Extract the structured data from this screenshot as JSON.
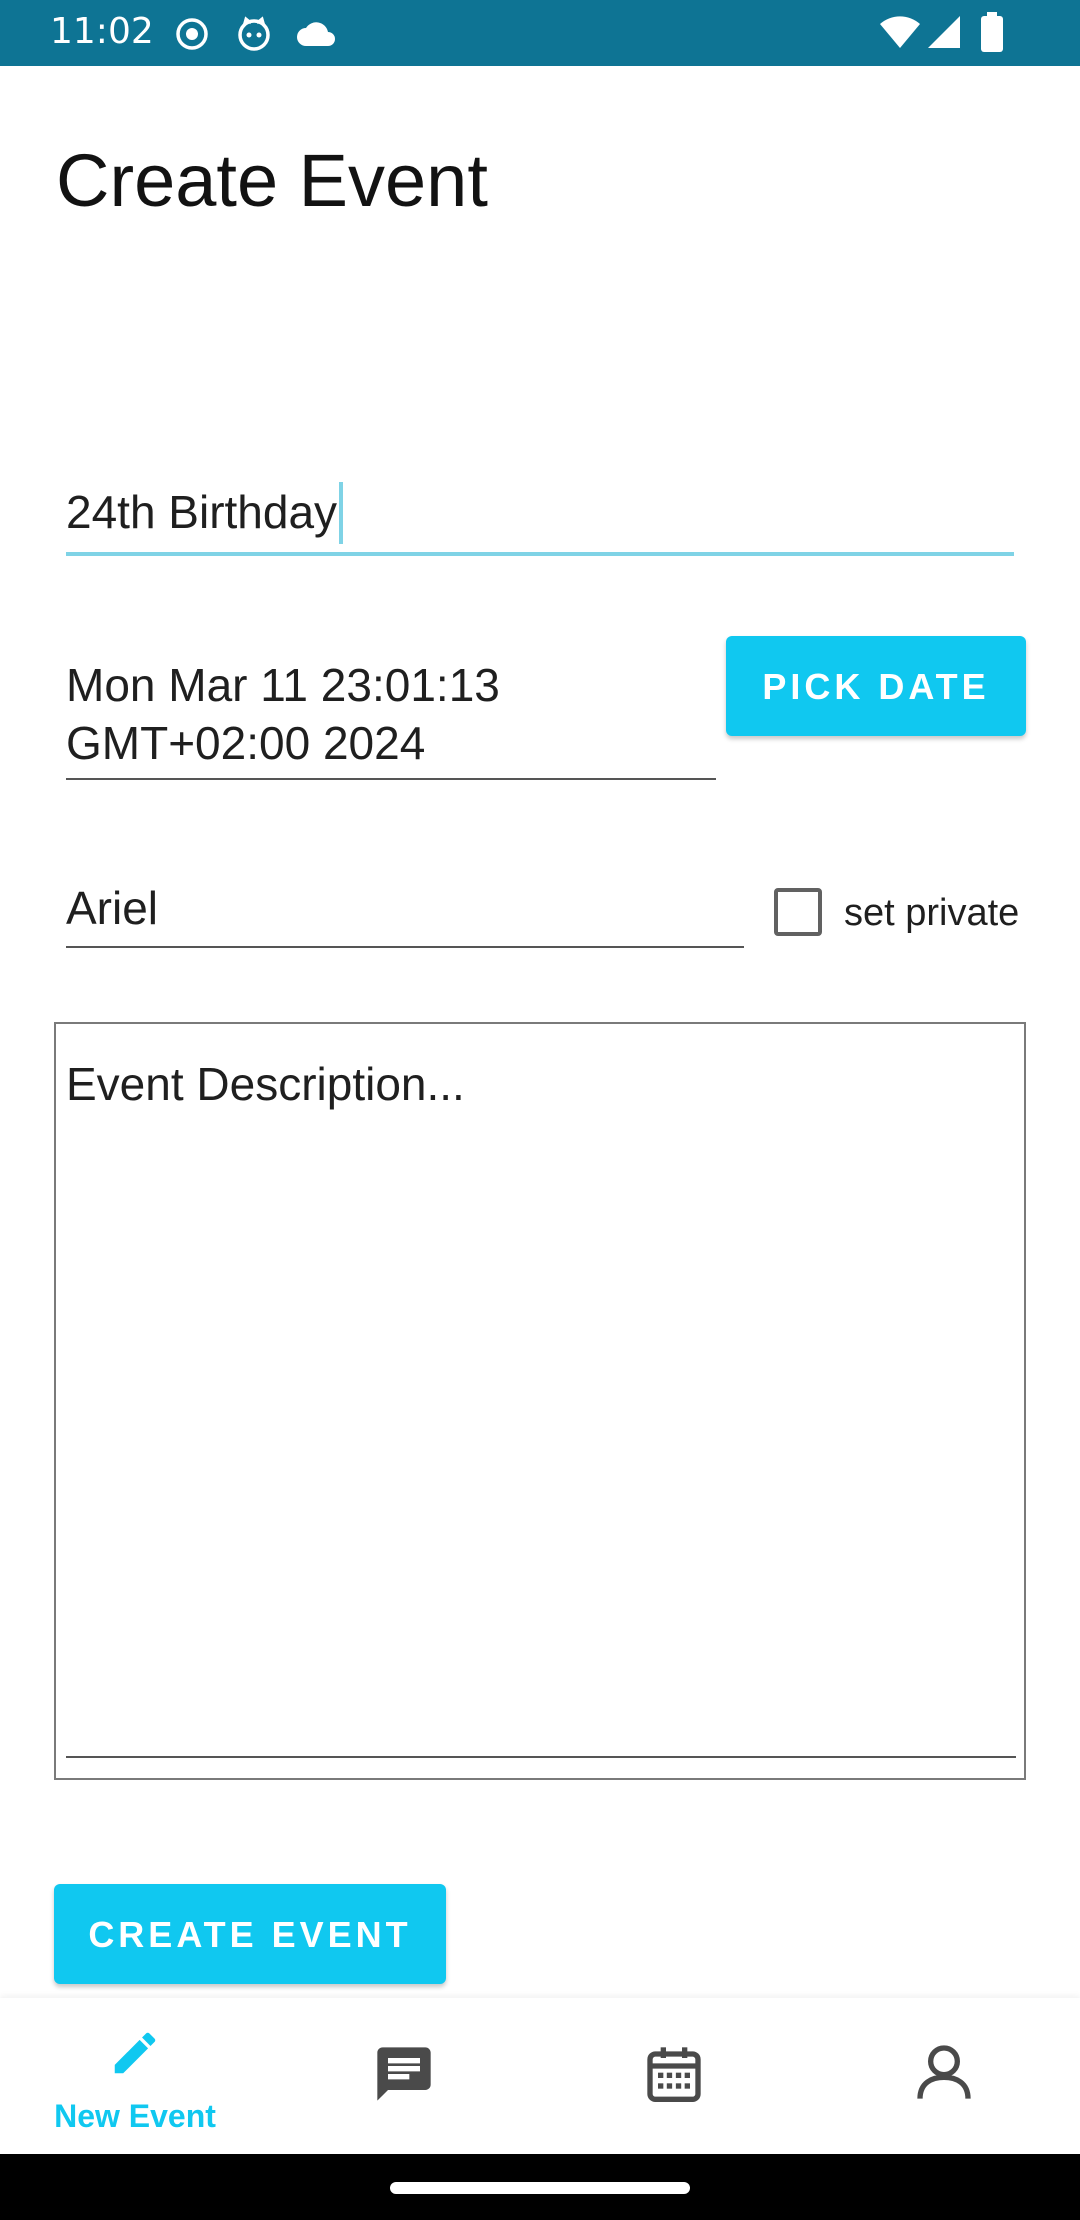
{
  "status_bar": {
    "time": "11:02",
    "background": "#0e7494",
    "left_icons": [
      "radio-signal-icon",
      "cat-face-icon",
      "cloud-icon"
    ],
    "right_icons": [
      "wifi-icon",
      "cellular-signal-icon",
      "battery-icon"
    ]
  },
  "page": {
    "title": "Create Event"
  },
  "form": {
    "event_name": "24th Birthday",
    "date_value": "Mon Mar 11 23:01:13 GMT+02:00 2024",
    "pick_date_label": "PICK DATE",
    "host_name": "Ariel",
    "private_checkbox": {
      "label": "set private",
      "checked": false
    },
    "description_placeholder": "Event Description...",
    "create_label": "CREATE EVENT"
  },
  "bottom_nav": {
    "items": [
      {
        "label": "New Event",
        "icon": "pencil-icon",
        "active": true
      },
      {
        "label": "",
        "icon": "chat-icon",
        "active": false
      },
      {
        "label": "",
        "icon": "calendar-icon",
        "active": false
      },
      {
        "label": "",
        "icon": "person-icon",
        "active": false
      }
    ]
  },
  "colors": {
    "accent": "#10c8f0",
    "field_focus": "#7fd3e6",
    "nav_inactive": "#4a4a4a"
  }
}
